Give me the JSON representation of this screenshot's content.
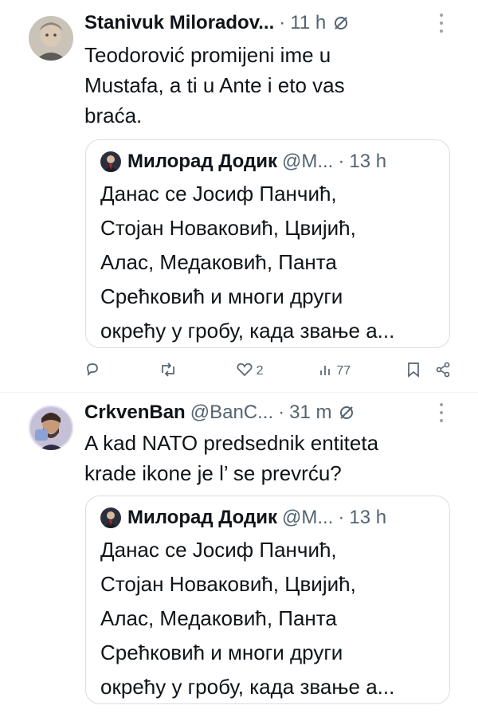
{
  "tweets": [
    {
      "name": "Stanivuk Miloradov...",
      "handle": "",
      "time": "11 h",
      "text": "Teodorović promijeni ime u\nMustafa, a ti u Ante i eto vas\nbraća.",
      "quote": {
        "name": "Милорад Додик",
        "handle": "@М...",
        "time": "13 h",
        "text": "Данас се Јосиф Панчић,\nСтојан Новаковић, Цвијић,\nАлас, Медаковић, Панта\nСрећковић и многи други\nокрећу у гробу, када звање а..."
      },
      "actions": {
        "reply_count": "",
        "retweet_count": "",
        "like_count": "2",
        "view_count": "77"
      }
    },
    {
      "name": "CrkvenBan",
      "handle": "@BanC...",
      "time": "31 m",
      "text": "A kad NATO predsednik entiteta\nkrade ikone je l’ se prevrću?",
      "quote": {
        "name": "Милорад Додик",
        "handle": "@М...",
        "time": "13 h",
        "text": "Данас се Јосиф Панчић,\nСтојан Новаковић, Цвијић,\nАлас, Медаковић, Панта\nСрећковић и многи други\nокрећу у гробу, када звање а..."
      }
    }
  ],
  "colors": {
    "text": "#0f1419",
    "muted": "#536471",
    "border": "#d8dee3",
    "divider": "#eff3f4"
  },
  "icons": [
    "reply-icon",
    "retweet-icon",
    "like-icon",
    "views-icon",
    "bookmark-icon",
    "share-icon",
    "grok-icon",
    "more-icon"
  ]
}
